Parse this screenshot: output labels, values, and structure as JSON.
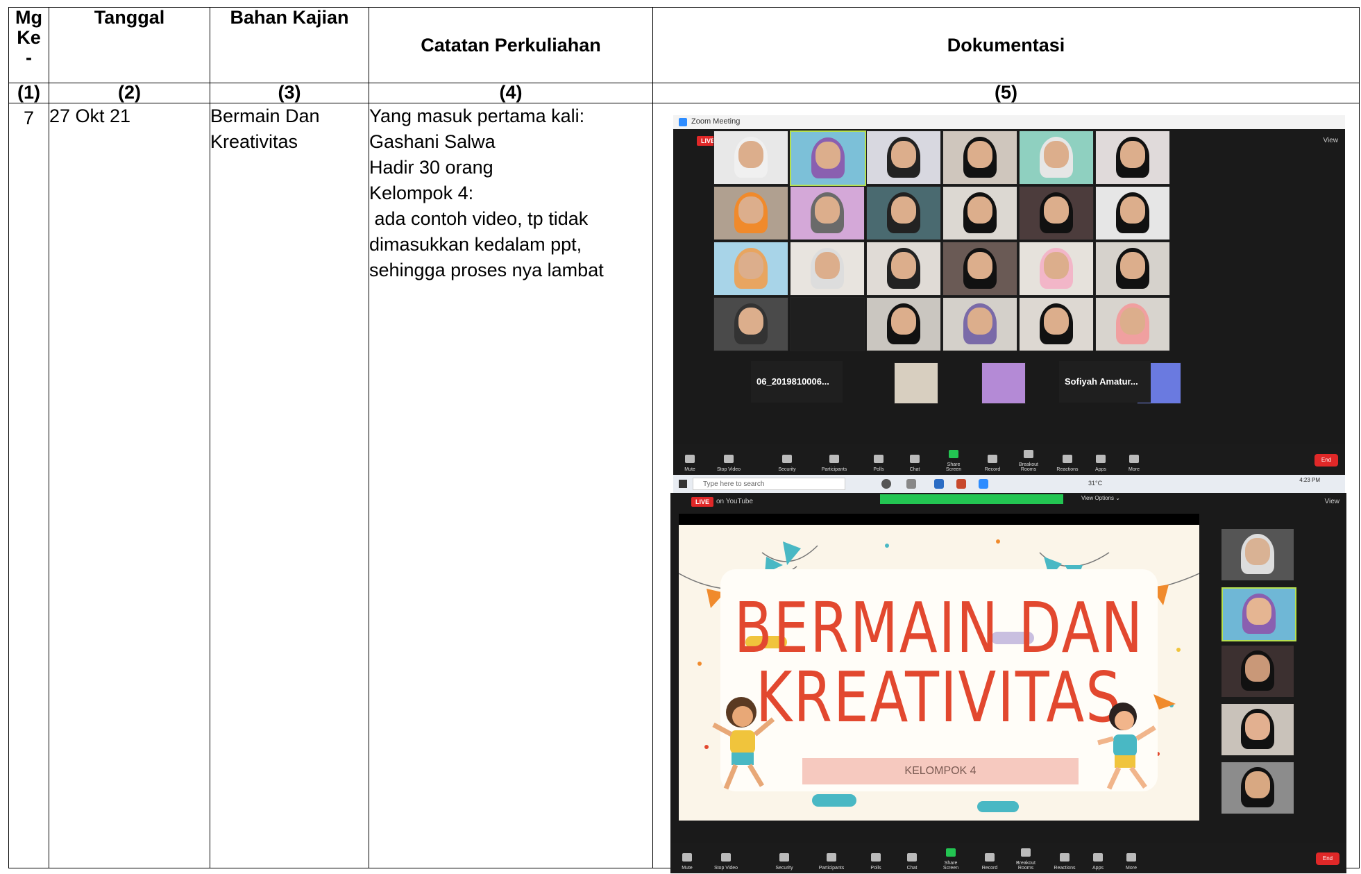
{
  "header": {
    "mg_ke": "Mg\nKe\n-",
    "tanggal": "Tanggal",
    "bahan_kajian": "Bahan Kajian",
    "catatan_perkuliahan": "Catatan Perkuliahan",
    "dokumentasi": "Dokumentasi"
  },
  "column_numbers": [
    "(1)",
    "(2)",
    "(3)",
    "(4)",
    "(5)"
  ],
  "row": {
    "mg_ke": "7",
    "tanggal": "27 Okt 21",
    "bahan_kajian_lines": [
      "Bermain Dan",
      "Kreativitas"
    ],
    "catatan_lines": [
      "Yang masuk pertama kali:",
      "Gashani Salwa",
      "Hadir 30 orang",
      "Kelompok 4:",
      " ada contoh video, tp tidak",
      "dimasukkan kedalam ppt,",
      "sehingga proses nya lambat"
    ]
  },
  "zoom_meeting": {
    "window_title": "Zoom Meeting",
    "live_badge": "LIVE",
    "stream_target": "on YouTube",
    "view_label": "View",
    "name_tiles": [
      "06_2019810006...",
      "Sofiyah Amatur..."
    ],
    "toolbar": [
      "Mute",
      "Stop Video",
      "Security",
      "Participants",
      "Polls",
      "Chat",
      "Share Screen",
      "Record",
      "Breakout Rooms",
      "Reactions",
      "Apps",
      "More"
    ],
    "end_label": "End",
    "taskbar_search": "Type here to search",
    "temperature": "31°C",
    "clock": "4:23 PM"
  },
  "slide": {
    "title_line1": "BERMAIN DAN",
    "title_line2": "KREATIVITAS",
    "subtitle": "KELOMPOK 4"
  },
  "colors": {
    "slide_title": "#e2482f",
    "zoom_bg": "#1a1a1a",
    "live_red": "#e02828",
    "active_green": "#b6e04f"
  }
}
